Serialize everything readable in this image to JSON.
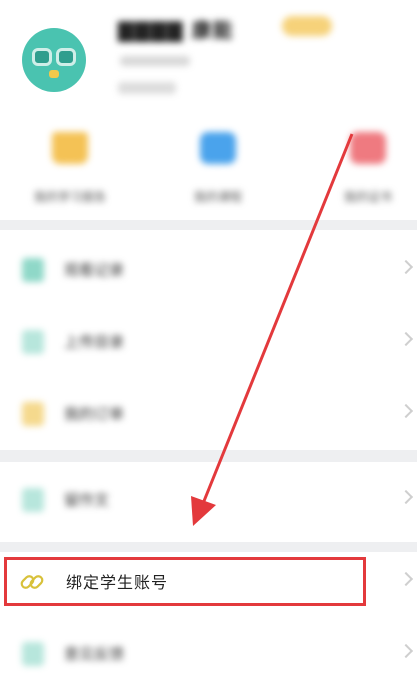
{
  "profile": {
    "name_tail": "康能"
  },
  "quick_actions": [
    {
      "icon": "book-icon",
      "label": "我的学习报告"
    },
    {
      "icon": "play-icon",
      "label": "我的课程"
    },
    {
      "icon": "certificate-icon",
      "label": "我的证书"
    }
  ],
  "menu": {
    "group1": [
      {
        "icon": "list-icon",
        "label": "观看记录"
      },
      {
        "icon": "upload-icon",
        "label": "上传目录"
      },
      {
        "icon": "order-icon",
        "label": "我的订单"
      }
    ],
    "group2": [
      {
        "icon": "note-icon",
        "label": "留作文"
      }
    ],
    "bind": {
      "icon": "link-icon",
      "label": "绑定学生账号"
    },
    "group3": [
      {
        "icon": "feedback-icon",
        "label": "意见反馈"
      }
    ]
  },
  "colors": {
    "highlight": "#e3393c",
    "link_icon": "#d8c13a"
  }
}
